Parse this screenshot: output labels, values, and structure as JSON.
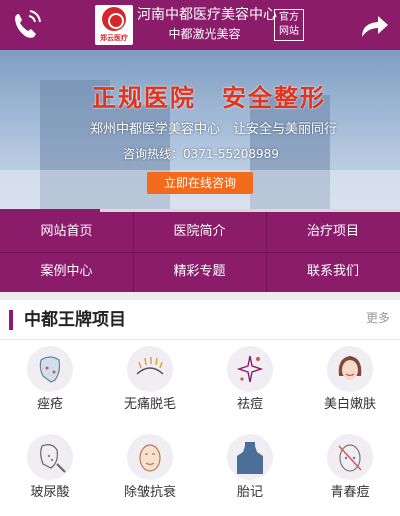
{
  "header": {
    "logo_badge_text": "郑云医疗",
    "logo_title": "河南中都医疗美容中心",
    "logo_subtitle": "中都激光美容",
    "official_label_line1": "官方",
    "official_label_line2": "网站",
    "phone_icon": "phone-icon",
    "share_icon": "share-arrow-icon"
  },
  "banner": {
    "slogan": "正规医院　安全整形",
    "tagline": "郑州中都医学美容中心　让安全与美丽同行",
    "hotline": "咨询热线：0371-55208989",
    "consult_button": "立即在线咨询",
    "slide_progress": 0.25
  },
  "nav": {
    "items": [
      {
        "label": "网站首页"
      },
      {
        "label": "医院简介"
      },
      {
        "label": "治疗项目"
      },
      {
        "label": "案例中心"
      },
      {
        "label": "精彩专题"
      },
      {
        "label": "联系我们"
      }
    ]
  },
  "section": {
    "title": "中都王牌项目",
    "more": "更多"
  },
  "projects": [
    {
      "label": "痤疮",
      "icon": "acne-face-icon"
    },
    {
      "label": "无痛脱毛",
      "icon": "hair-removal-icon"
    },
    {
      "label": "祛痘",
      "icon": "pimple-removal-icon"
    },
    {
      "label": "美白嫩肤",
      "icon": "whitening-face-icon"
    },
    {
      "label": "玻尿酸",
      "icon": "hyaluronic-face-icon"
    },
    {
      "label": "除皱抗衰",
      "icon": "anti-wrinkle-face-icon"
    },
    {
      "label": "胎记",
      "icon": "birthmark-icon"
    },
    {
      "label": "青春痘",
      "icon": "youth-acne-icon"
    }
  ],
  "colors": {
    "brand": "#8a1c6a",
    "slogan": "#e0341e",
    "button": "#f26b1d"
  }
}
